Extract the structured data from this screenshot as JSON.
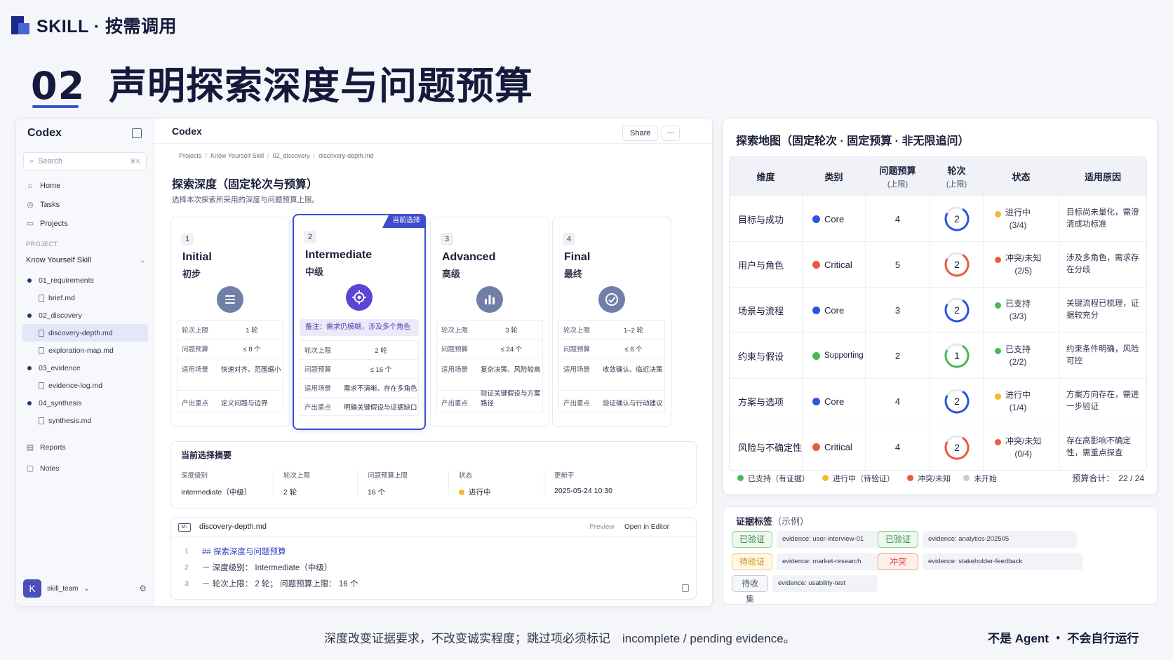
{
  "brand": {
    "text": "SKILL · 按需调用"
  },
  "headline": {
    "number": "02",
    "title": "声明探索深度与问题预算"
  },
  "app": {
    "sidebar": {
      "title": "Codex",
      "search_placeholder": "Search",
      "search_kbd": "⌘K",
      "nav": [
        {
          "label": "Home",
          "icon": "home-icon"
        },
        {
          "label": "Tasks",
          "icon": "check-circle-icon"
        },
        {
          "label": "Projects",
          "icon": "folder-icon"
        }
      ],
      "project_label": "PROJECT",
      "project_name": "Know Yourself Skill",
      "tree": [
        {
          "type": "folder",
          "label": "01_requirements"
        },
        {
          "type": "file",
          "label": "brief.md"
        },
        {
          "type": "folder",
          "label": "02_discovery"
        },
        {
          "type": "file",
          "label": "discovery-depth.md",
          "active": true
        },
        {
          "type": "file",
          "label": "exploration-map.md"
        },
        {
          "type": "folder",
          "label": "03_evidence"
        },
        {
          "type": "file",
          "label": "evidence-log.md"
        },
        {
          "type": "folder",
          "label": "04_synthesis"
        },
        {
          "type": "file",
          "label": "synthesis.md"
        }
      ],
      "bottom_nav": [
        {
          "label": "Reports",
          "icon": "report-icon"
        },
        {
          "label": "Notes",
          "icon": "note-icon"
        }
      ],
      "user": {
        "avatar": "K",
        "name": "skill_team"
      }
    },
    "main": {
      "title": "Codex",
      "share": "Share",
      "more": "···",
      "breadcrumb": [
        "Projects",
        "Know Yourself Skill",
        "02_discovery",
        "discovery-depth.md"
      ],
      "section_title": "探索深度（固定轮次与预算）",
      "section_sub": "选择本次探索所采用的深度与问题预算上限。",
      "cards": [
        {
          "num": "1",
          "en": "Initial",
          "zh": "初步",
          "icon": "list-icon",
          "rows": [
            {
              "k": "轮次上限",
              "v": "1 轮"
            },
            {
              "k": "问题预算",
              "v": "≤ 8 个"
            },
            {
              "k": "适用场景",
              "v": "快速对齐、范围缩小"
            },
            {
              "k": "产出重点",
              "v": "定义问题与边界"
            }
          ]
        },
        {
          "num": "2",
          "en": "Intermediate",
          "zh": "中级",
          "icon": "target-icon",
          "badge": "当前选择",
          "note": "备注：需求仍模糊，涉及多个角色",
          "rows": [
            {
              "k": "轮次上限",
              "v": "2 轮"
            },
            {
              "k": "问题预算",
              "v": "≤ 16 个"
            },
            {
              "k": "适用场景",
              "v": "需求不清晰、存在多角色"
            },
            {
              "k": "产出重点",
              "v": "明确关键假设与证据缺口"
            }
          ]
        },
        {
          "num": "3",
          "en": "Advanced",
          "zh": "高级",
          "icon": "bar-chart-icon",
          "rows": [
            {
              "k": "轮次上限",
              "v": "3 轮"
            },
            {
              "k": "问题预算",
              "v": "≤ 24 个"
            },
            {
              "k": "适用场景",
              "v": "复杂决策、风险较高"
            },
            {
              "k": "产出重点",
              "v": "验证关键假设与方案路径"
            }
          ]
        },
        {
          "num": "4",
          "en": "Final",
          "zh": "最终",
          "icon": "check-circle-icon",
          "rows": [
            {
              "k": "轮次上限",
              "v": "1–2 轮"
            },
            {
              "k": "问题预算",
              "v": "≤ 8 个"
            },
            {
              "k": "适用场景",
              "v": "收敛确认、临近决策"
            },
            {
              "k": "产出重点",
              "v": "验证确认与行动建议"
            }
          ]
        }
      ],
      "summary": {
        "title": "当前选择摘要",
        "cols": [
          {
            "k": "深度级别",
            "v": "Intermediate（中级）"
          },
          {
            "k": "轮次上限",
            "v": "2 轮"
          },
          {
            "k": "问题预算上限",
            "v": "16 个"
          },
          {
            "k": "状态",
            "v": "进行中"
          },
          {
            "k": "更新于",
            "v": "2025-05-24 10:30"
          }
        ]
      },
      "editor": {
        "badge": "M↓",
        "filename": "discovery-depth.md",
        "preview": "Preview",
        "open": "Open in Editor",
        "lines": [
          {
            "n": "1",
            "t": "## 探索深度与问题预算"
          },
          {
            "n": "2",
            "t": "－ 深度级别： Intermediate（中级）"
          },
          {
            "n": "3",
            "t": "－ 轮次上限： 2 轮； 问题预算上限： 16 个"
          }
        ]
      }
    }
  },
  "map": {
    "title": "探索地图（固定轮次 · 固定预算 · 非无限追问）",
    "headers": [
      {
        "t": "维度"
      },
      {
        "t": "类别"
      },
      {
        "t": "问题预算",
        "sub": "(上限)"
      },
      {
        "t": "轮次",
        "sub": "(上限)"
      },
      {
        "t": "状态"
      },
      {
        "t": "适用原因"
      }
    ],
    "rows": [
      {
        "dim": "目标与成功",
        "cat": "Core",
        "catColor": "#2a55e0",
        "budget": "4",
        "rounds": 2,
        "ringColor": "#2a55e0",
        "ringFrac": 0.75,
        "statusColor": "#f5b82e",
        "status": "进行中",
        "progress": "(3/4)",
        "reason": "目标尚未量化，需澄清成功标准"
      },
      {
        "dim": "用户与角色",
        "cat": "Critical",
        "catColor": "#ea5a3f",
        "budget": "5",
        "rounds": 2,
        "ringColor": "#ea5a3f",
        "ringFrac": 0.75,
        "statusColor": "#ea5a3f",
        "status": "冲突/未知",
        "progress": "(2/5)",
        "reason": "涉及多角色，需求存在分歧"
      },
      {
        "dim": "场景与流程",
        "cat": "Core",
        "catColor": "#2a55e0",
        "budget": "3",
        "rounds": 2,
        "ringColor": "#2a55e0",
        "ringFrac": 0.75,
        "statusColor": "#47b85a",
        "status": "已支持",
        "progress": "(3/3)",
        "reason": "关键流程已梳理，证据较充分"
      },
      {
        "dim": "约束与假设",
        "cat": "Supporting",
        "catColor": "#47b85a",
        "budget": "2",
        "rounds": 1,
        "ringColor": "#47b85a",
        "ringFrac": 0.75,
        "statusColor": "#47b85a",
        "status": "已支持",
        "progress": "(2/2)",
        "reason": "约束条件明确，风险可控"
      },
      {
        "dim": "方案与选项",
        "cat": "Core",
        "catColor": "#2a55e0",
        "budget": "4",
        "rounds": 2,
        "ringColor": "#2a55e0",
        "ringFrac": 0.75,
        "statusColor": "#f5b82e",
        "status": "进行中",
        "progress": "(1/4)",
        "reason": "方案方向存在，需进一步验证"
      },
      {
        "dim": "风险与不确定性",
        "cat": "Critical",
        "catColor": "#ea5a3f",
        "budget": "4",
        "rounds": 2,
        "ringColor": "#ea5a3f",
        "ringFrac": 0.75,
        "statusColor": "#ea5a3f",
        "status": "冲突/未知",
        "progress": "(0/4)",
        "reason": "存在高影响不确定性，需重点探查"
      }
    ],
    "legend": [
      {
        "label": "已支持（有证据）",
        "color": "#47b85a"
      },
      {
        "label": "进行中（待验证）",
        "color": "#f5b82e"
      },
      {
        "label": "冲突/未知",
        "color": "#ea5a3f"
      },
      {
        "label": "未开始",
        "color": "#c9ccd6"
      }
    ],
    "total_label": "预算合计：",
    "total_value": "22 / 24"
  },
  "tags": {
    "title": "证据标签",
    "title_light": "（示例）",
    "items": [
      {
        "chip": "已验证",
        "style": "green",
        "evidence": "evidence: user-interview-01"
      },
      {
        "chip": "已验证",
        "style": "green",
        "evidence": "evidence: analytics-202505"
      },
      {
        "chip": "待验证",
        "style": "yellow",
        "evidence": "evidence: market-research"
      },
      {
        "chip": "冲突",
        "style": "red",
        "evidence": "evidence: stakeholder-feedback"
      },
      {
        "chip": "待收集",
        "style": "gray",
        "evidence": "evidence: usability-test"
      }
    ]
  },
  "footer": {
    "note": "深度改变证据要求，不改变诚实程度；跳过项必须标记　incomplete / pending evidence。",
    "right": "不是 Agent ・ 不会自行运行"
  }
}
